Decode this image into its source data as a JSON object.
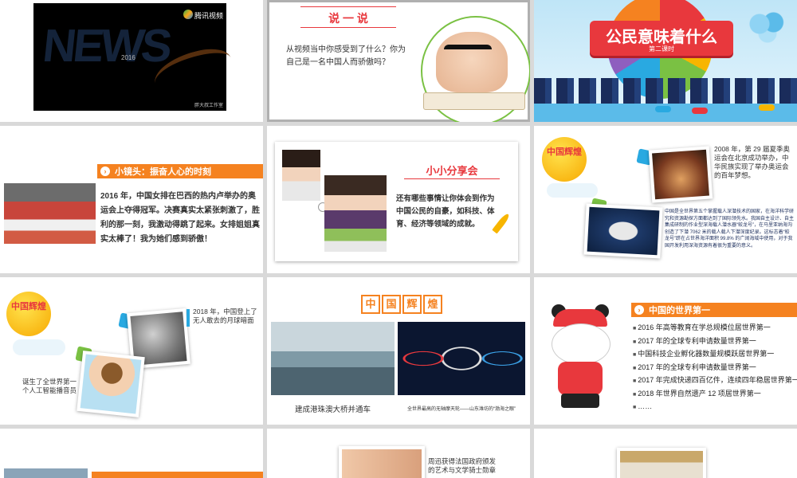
{
  "slide1": {
    "logo_text": "腾讯视频",
    "year": "2016",
    "bigword": "NEWS",
    "credit": "胖大叔工作室"
  },
  "slide2": {
    "title": "说 一 说",
    "question": "从视频当中你感受到了什么？你为自己是一名中国人而骄傲吗？"
  },
  "slide3": {
    "title": "公民意味着什么",
    "subtitle": "第二课时"
  },
  "slide4": {
    "header": "小镜头：振奋人心的时刻",
    "body": "2016 年，中国女排在巴西的热内卢举办的奥运会上夺得冠军。决赛真实太紧张刺激了，胜利的那一刻，我激动得跳了起来。女排姐姐真实太棒了！我为她们感到骄傲！"
  },
  "slide5": {
    "title": "小小分享会",
    "body": "还有哪些事情让你体会到作为中国公民的自豪，如科技、体育、经济等领域的成就。"
  },
  "slide6": {
    "badge": "中国辉煌",
    "caption1": "2008 年，第 29 届夏季奥运会在北京成功举办，中华民族实现了举办奥运会的百年梦想。",
    "caption2": "中国是全世界第五个掌握载人深潜技术的国家，在海洋科学研究和资源勘探方面都达到了国际领先水。我国自主设计、自主集成研制的作业型深海载人潜水器“蛟龙号”，在马里亚纳海沟创造了下潜 7062 米的载人载人下潜深度纪录。这标志着“蛟龙号”跻在占世界海洋面积 99.8% 的广阔海域中使用，对于我国开发利用深海资源有着很为重要的意义。"
  },
  "slide7": {
    "badge": "中国辉煌",
    "caption1": "2018 年，中国登上了无人敢去的月球暗面",
    "caption2": "诞生了全世界第一个人工智能播音员"
  },
  "slide8": {
    "title_chars": [
      "中",
      "国",
      "辉",
      "煌"
    ],
    "caption_left": "建成港珠澳大桥并通车",
    "caption_right": "全世界最高的无轴摩天轮——山东潍坊的“渤海之眼”"
  },
  "slide9": {
    "header": "中国的世界第一",
    "items": [
      "2016 年高等教育在学总规模位居世界第一",
      "2017 年的全球专利申请数量世界第一",
      "中国科技企业孵化器数量规模跃居世界第一",
      "2017 年的全球专利申请数量世界第一",
      "2017 年完成快递四百亿件，连续四年稳居世界第一",
      "2018 年世界自然遗产 12 项居世界第一",
      "……"
    ]
  },
  "slide11": {
    "caption": "周迅获得法国政府颁发的艺术与文学骑士勋章"
  },
  "colors": {
    "orange": "#f58220",
    "red": "#e8383d",
    "badge_yellow": "#f7b500",
    "navy": "#1a2c5b"
  }
}
